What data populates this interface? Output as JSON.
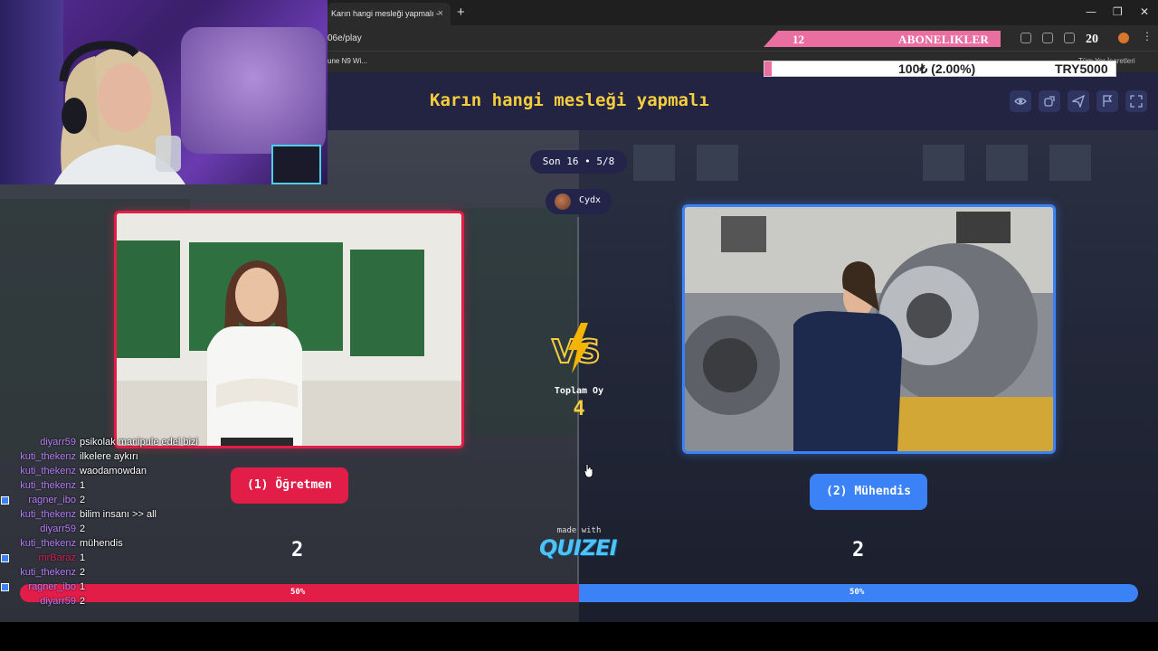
{
  "browser": {
    "tab_title": "Karın hangi mesleği yapmalı - ",
    "tab_close": "×",
    "new_tab": "+",
    "url": "06e/play",
    "bookmark": "une N9 Wi...",
    "bookmarks_all": "Tüm Yer İşaretleri",
    "window_controls": [
      "—",
      "❐",
      "✕"
    ]
  },
  "overlay": {
    "sub_count": "12",
    "sub_label": "ABONELIKLER",
    "ext_count": "20",
    "goal_current": "100₺ (2.00%)",
    "goal_target": "TRY5000",
    "goal_progress": 0.02
  },
  "quiz": {
    "title": "Karın hangi mesleği yapmalı",
    "round": "Son 16 • 5/8",
    "creator": "Cydx",
    "total_label": "Toplam Oy",
    "total_value": "4",
    "left": {
      "label": "(1) Öğretmen",
      "votes": "2",
      "percent": "50%",
      "color": "#e11d48"
    },
    "right": {
      "label": "(2) Mühendis",
      "votes": "2",
      "percent": "50%",
      "color": "#3b82f6"
    },
    "made_with": "made with",
    "brand": "QUIZEI",
    "share_left": 0.5
  },
  "chat": [
    {
      "user": "diyarr59",
      "msg": "psikolak manipule edel bizi",
      "color": "#b57cf5",
      "badge": false
    },
    {
      "user": "kuti_thekenz",
      "msg": "ilkelere aykırı",
      "color": "#b57cf5",
      "badge": false
    },
    {
      "user": "kuti_thekenz",
      "msg": "waodamowdan",
      "color": "#b57cf5",
      "badge": false
    },
    {
      "user": "kuti_thekenz",
      "msg": "1",
      "color": "#b57cf5",
      "badge": false
    },
    {
      "user": "ragner_ibo",
      "msg": "2",
      "color": "#b57cf5",
      "badge": true
    },
    {
      "user": "kuti_thekenz",
      "msg": "bilim insanı >> all",
      "color": "#b57cf5",
      "badge": false
    },
    {
      "user": "diyarr59",
      "msg": "2",
      "color": "#b57cf5",
      "badge": false
    },
    {
      "user": "kuti_thekenz",
      "msg": "mühendis",
      "color": "#b57cf5",
      "badge": false
    },
    {
      "user": "mrBaraz",
      "msg": "1",
      "color": "#d6205a",
      "badge": true
    },
    {
      "user": "kuti_thekenz",
      "msg": "2",
      "color": "#b57cf5",
      "badge": false
    },
    {
      "user": "ragner_ibo",
      "msg": "1",
      "color": "#b57cf5",
      "badge": true
    },
    {
      "user": "diyarr59",
      "msg": "2",
      "color": "#b57cf5",
      "badge": false
    }
  ]
}
